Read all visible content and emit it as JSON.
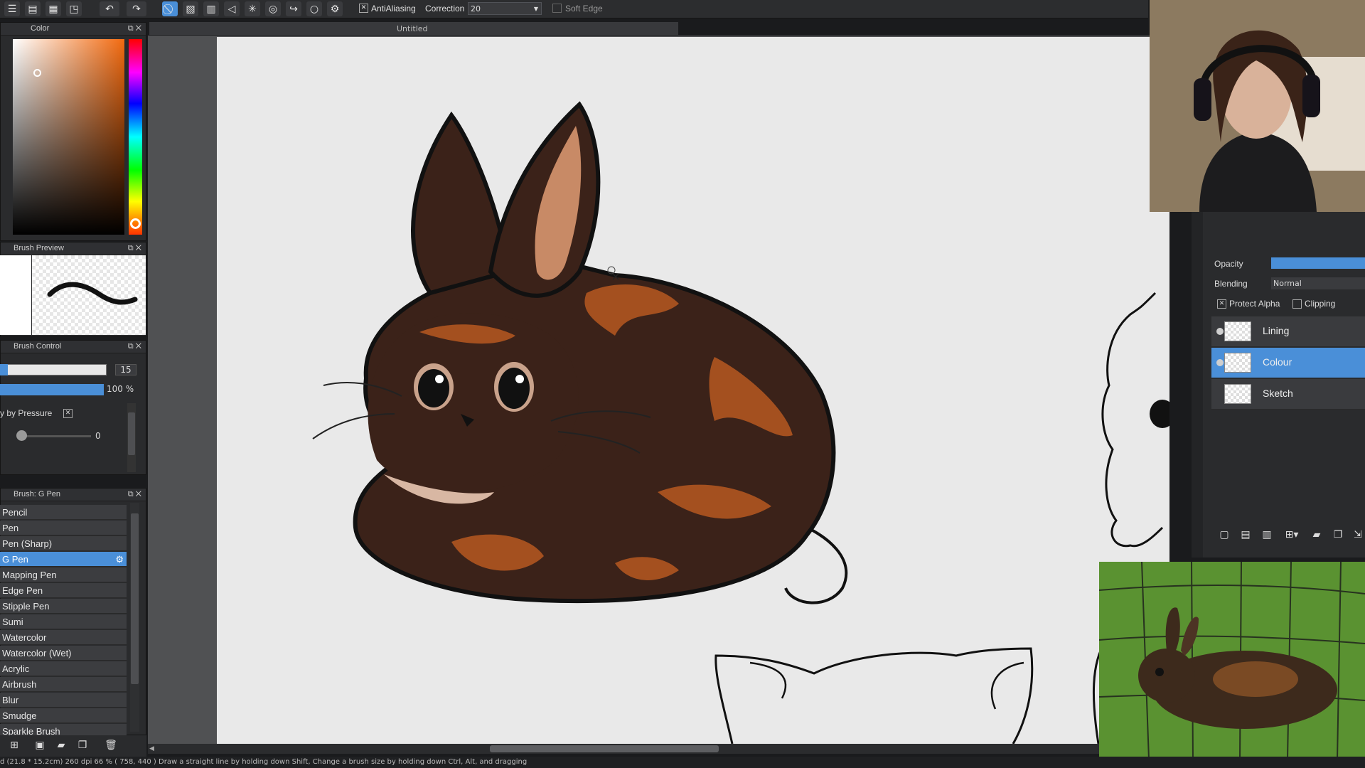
{
  "toolbar": {
    "antialiasing_label": "AntiAliasing",
    "correction_label": "Correction",
    "correction_value": "20",
    "soft_edge_label": "Soft Edge"
  },
  "canvas": {
    "title": "Untitled"
  },
  "color_panel": {
    "title": "Color"
  },
  "brush_preview": {
    "title": "Brush Preview"
  },
  "brush_control": {
    "title": "Brush Control",
    "size_value": "15",
    "size_fraction": 0.07,
    "opacity_value": "100 %",
    "pressure_label": "y by Pressure",
    "min_value": "0"
  },
  "brush_list": {
    "title": "Brush: G Pen",
    "items": [
      "Pencil",
      "Pen",
      "Pen (Sharp)",
      "G Pen",
      "Mapping Pen",
      "Edge Pen",
      "Stipple Pen",
      "Sumi",
      "Watercolor",
      "Watercolor (Wet)",
      "Acrylic",
      "Airbrush",
      "Blur",
      "Smudge",
      "Sparkle Brush"
    ],
    "selected": "G Pen"
  },
  "layers": {
    "opacity_label": "Opacity",
    "blending_label": "Blending",
    "blending_value": "Normal",
    "protect_alpha_label": "Protect Alpha",
    "clipping_label": "Clipping",
    "items": [
      {
        "name": "Lining",
        "selected": false
      },
      {
        "name": "Colour",
        "selected": true
      },
      {
        "name": "Sketch",
        "selected": false
      }
    ]
  },
  "status_bar": {
    "text": "d (21.8 * 15.2cm) 260 dpi  66 %  ( 758, 440 )  Draw a straight line by holding down Shift, Change a brush size by holding down Ctrl, Alt, and dragging"
  },
  "colors": {
    "accent": "#4a8fd8",
    "panel": "#2a2b2d",
    "bunny_dark": "#3a2218",
    "bunny_orange": "#a4501f"
  }
}
